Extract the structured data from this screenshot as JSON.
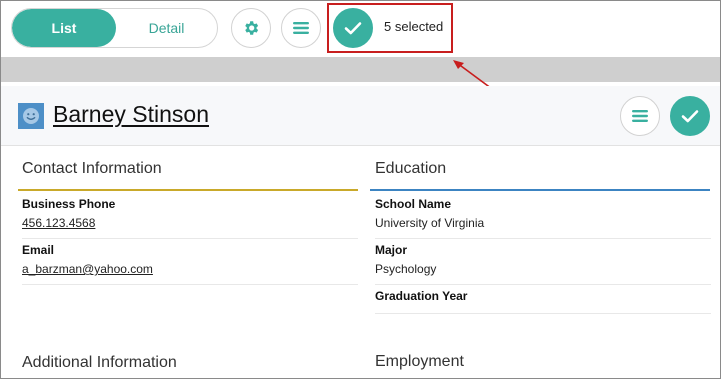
{
  "toolbar": {
    "view_toggle": {
      "list_label": "List",
      "detail_label": "Detail",
      "selected": "List"
    },
    "settings_icon": "gear-icon",
    "menu_icon": "hamburger-icon",
    "select_icon": "checkmark-icon",
    "selection_text": "5 selected"
  },
  "record": {
    "avatar_icon": "smiley-face-icon",
    "name": "Barney Stinson",
    "menu_icon": "hamburger-icon",
    "check_icon": "checkmark-icon"
  },
  "sections": {
    "contact": {
      "title": "Contact Information",
      "fields": [
        {
          "label": "Business Phone",
          "value": "456.123.4568"
        },
        {
          "label": "Email",
          "value": "a_barzman@yahoo.com"
        }
      ]
    },
    "education": {
      "title": "Education",
      "fields": [
        {
          "label": "School Name",
          "value": "University of Virginia"
        },
        {
          "label": "Major",
          "value": "Psychology"
        },
        {
          "label": "Graduation Year",
          "value": ""
        }
      ]
    },
    "additional": {
      "title": "Additional Information"
    },
    "employment": {
      "title": "Employment"
    }
  },
  "colors": {
    "accent": "#39b0a0",
    "highlight_box": "#c81e1e",
    "contact_rule": "#c9a92a",
    "education_rule": "#3c84c2",
    "avatar_bg": "#4d8fc7"
  }
}
